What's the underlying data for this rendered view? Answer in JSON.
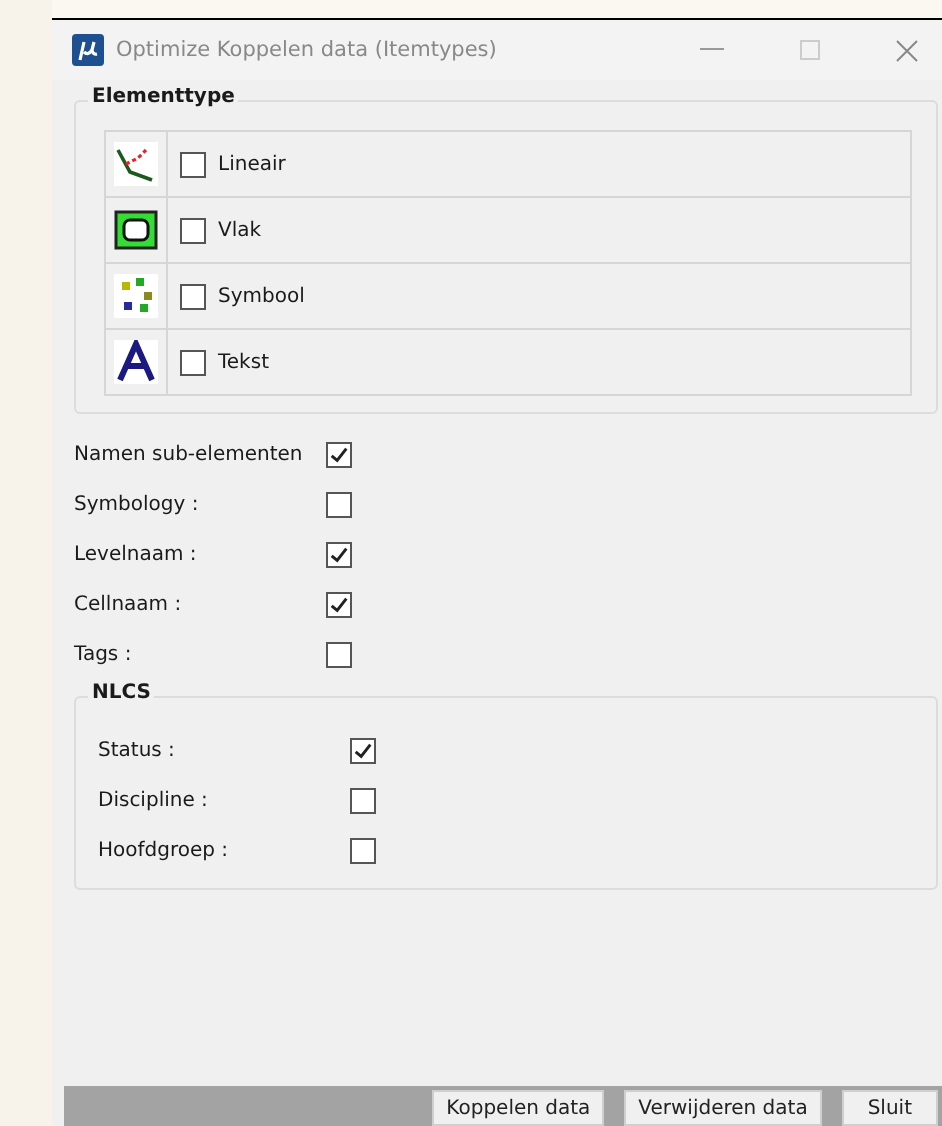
{
  "window": {
    "title": "Optimize Koppelen data (Itemtypes)"
  },
  "elementtype": {
    "title": "Elementtype",
    "items": [
      {
        "kind": "line",
        "label": "Lineair",
        "checked": false
      },
      {
        "kind": "shape",
        "label": "Vlak",
        "checked": false
      },
      {
        "kind": "symbol",
        "label": "Symbool",
        "checked": false
      },
      {
        "kind": "text",
        "label": "Tekst",
        "checked": false
      }
    ]
  },
  "options": [
    {
      "label": "Namen sub-elementen",
      "checked": true
    },
    {
      "label": "Symbology :",
      "checked": false
    },
    {
      "label": "Levelnaam :",
      "checked": true
    },
    {
      "label": "Cellnaam :",
      "checked": true
    },
    {
      "label": "Tags :",
      "checked": false
    }
  ],
  "nlcs": {
    "title": "NLCS",
    "items": [
      {
        "label": "Status :",
        "checked": true
      },
      {
        "label": "Discipline :",
        "checked": false
      },
      {
        "label": "Hoofdgroep :",
        "checked": false
      }
    ]
  },
  "buttons": [
    "Koppelen data",
    "Verwijderen data",
    "Sluit"
  ]
}
